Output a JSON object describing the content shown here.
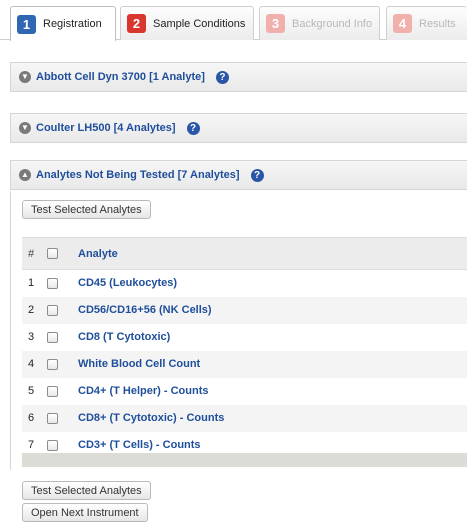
{
  "tabs": [
    {
      "number": "1",
      "label": "Registration",
      "state": "active",
      "color": "#2f67b3"
    },
    {
      "number": "2",
      "label": "Sample Conditions",
      "state": "enabled",
      "color": "#d9362f"
    },
    {
      "number": "3",
      "label": "Background Info",
      "state": "disabled",
      "color": "#f2b0ac"
    },
    {
      "number": "4",
      "label": "Results",
      "state": "disabled",
      "color": "#f2b0ac"
    }
  ],
  "panels": [
    {
      "title": "Abbott Cell Dyn 3700 [1 Analyte]",
      "state": "collapsed",
      "icon": "chevron-down-icon"
    },
    {
      "title": "Coulter LH500 [4 Analytes]",
      "state": "collapsed",
      "icon": "chevron-down-icon"
    },
    {
      "title": "Analytes Not Being Tested [7 Analytes]",
      "state": "expanded",
      "icon": "chevron-up-icon"
    }
  ],
  "help_glyph": "?",
  "analytes_panel": {
    "test_button_label": "Test Selected Analytes",
    "test_button_bottom_label": "Test Selected Analytes",
    "open_next_label": "Open Next Instrument",
    "table": {
      "columns": [
        "#",
        "",
        "Analyte"
      ],
      "rows": [
        {
          "num": "1",
          "analyte": "CD45 (Leukocytes)"
        },
        {
          "num": "2",
          "analyte": "CD56/CD16+56 (NK Cells)"
        },
        {
          "num": "3",
          "analyte": "CD8 (T Cytotoxic)"
        },
        {
          "num": "4",
          "analyte": "White Blood Cell Count"
        },
        {
          "num": "5",
          "analyte": "CD4+ (T Helper) - Counts"
        },
        {
          "num": "6",
          "analyte": "CD8+ (T Cytotoxic) - Counts"
        },
        {
          "num": "7",
          "analyte": "CD3+ (T Cells) - Counts"
        }
      ]
    }
  },
  "colors": {
    "link": "#1f4e9b",
    "help_icon": "#2a56a8"
  }
}
